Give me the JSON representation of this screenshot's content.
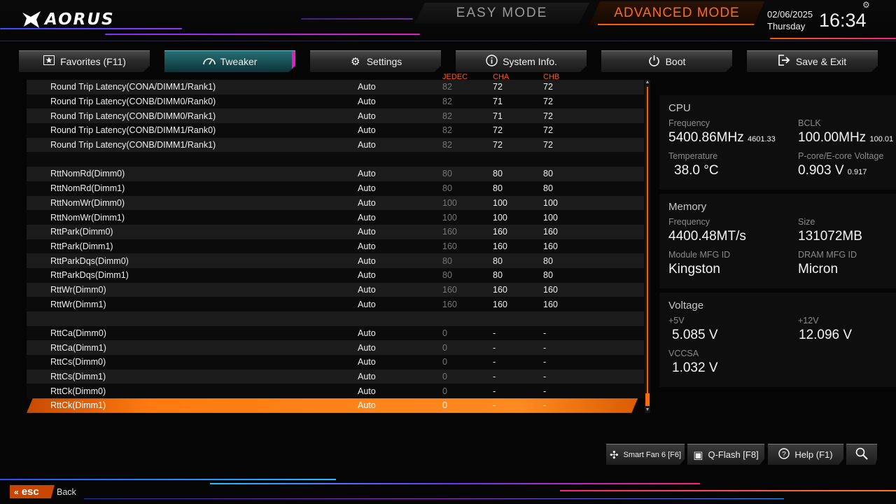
{
  "header": {
    "brand": "AORUS",
    "easy_mode": "EASY MODE",
    "advanced_mode": "ADVANCED MODE",
    "date": "02/06/2025",
    "day": "Thursday",
    "time": "16:34"
  },
  "tabs": [
    {
      "label": "Favorites (F11)",
      "icon": "star-icon"
    },
    {
      "label": "Tweaker",
      "icon": "speedometer-icon"
    },
    {
      "label": "Settings",
      "icon": "gear-icon"
    },
    {
      "label": "System Info.",
      "icon": "info-icon"
    },
    {
      "label": "Boot",
      "icon": "power-icon"
    },
    {
      "label": "Save & Exit",
      "icon": "exit-icon"
    }
  ],
  "columns": {
    "jedec": "JEDEC",
    "cha": "CHA",
    "chb": "CHB"
  },
  "rows": [
    {
      "name": "Round Trip Latency(CONA/DIMM1/Rank1)",
      "value": "Auto",
      "jedec": "82",
      "cha": "72",
      "chb": "72"
    },
    {
      "name": "Round Trip Latency(CONB/DIMM0/Rank0)",
      "value": "Auto",
      "jedec": "82",
      "cha": "71",
      "chb": "72"
    },
    {
      "name": "Round Trip Latency(CONB/DIMM0/Rank1)",
      "value": "Auto",
      "jedec": "82",
      "cha": "71",
      "chb": "72"
    },
    {
      "name": "Round Trip Latency(CONB/DIMM1/Rank0)",
      "value": "Auto",
      "jedec": "82",
      "cha": "72",
      "chb": "72"
    },
    {
      "name": "Round Trip Latency(CONB/DIMM1/Rank1)",
      "value": "Auto",
      "jedec": "82",
      "cha": "72",
      "chb": "72"
    },
    {
      "name": "",
      "value": "",
      "jedec": "",
      "cha": "",
      "chb": ""
    },
    {
      "name": "RttNomRd(Dimm0)",
      "value": "Auto",
      "jedec": "80",
      "cha": "80",
      "chb": "80"
    },
    {
      "name": "RttNomRd(Dimm1)",
      "value": "Auto",
      "jedec": "80",
      "cha": "80",
      "chb": "80"
    },
    {
      "name": "RttNomWr(Dimm0)",
      "value": "Auto",
      "jedec": "100",
      "cha": "100",
      "chb": "100"
    },
    {
      "name": "RttNomWr(Dimm1)",
      "value": "Auto",
      "jedec": "100",
      "cha": "100",
      "chb": "100"
    },
    {
      "name": "RttPark(Dimm0)",
      "value": "Auto",
      "jedec": "160",
      "cha": "160",
      "chb": "160"
    },
    {
      "name": "RttPark(Dimm1)",
      "value": "Auto",
      "jedec": "160",
      "cha": "160",
      "chb": "160"
    },
    {
      "name": "RttParkDqs(Dimm0)",
      "value": "Auto",
      "jedec": "80",
      "cha": "80",
      "chb": "80"
    },
    {
      "name": "RttParkDqs(Dimm1)",
      "value": "Auto",
      "jedec": "80",
      "cha": "80",
      "chb": "80"
    },
    {
      "name": "RttWr(Dimm0)",
      "value": "Auto",
      "jedec": "160",
      "cha": "160",
      "chb": "160"
    },
    {
      "name": "RttWr(Dimm1)",
      "value": "Auto",
      "jedec": "160",
      "cha": "160",
      "chb": "160"
    },
    {
      "name": "",
      "value": "",
      "jedec": "",
      "cha": "",
      "chb": ""
    },
    {
      "name": "RttCa(Dimm0)",
      "value": "Auto",
      "jedec": "0",
      "cha": "-",
      "chb": "-"
    },
    {
      "name": "RttCa(Dimm1)",
      "value": "Auto",
      "jedec": "0",
      "cha": "-",
      "chb": "-"
    },
    {
      "name": "RttCs(Dimm0)",
      "value": "Auto",
      "jedec": "0",
      "cha": "-",
      "chb": "-"
    },
    {
      "name": "RttCs(Dimm1)",
      "value": "Auto",
      "jedec": "0",
      "cha": "-",
      "chb": "-"
    },
    {
      "name": "RttCk(Dimm0)",
      "value": "Auto",
      "jedec": "0",
      "cha": "-",
      "chb": "-"
    },
    {
      "name": "RttCk(Dimm1)",
      "value": "Auto",
      "jedec": "0",
      "cha": "-",
      "chb": "-"
    }
  ],
  "selected_row": "RttCk(Dimm1)",
  "cpu": {
    "title": "CPU",
    "freq_label": "Frequency",
    "freq": "5400.86MHz",
    "freq_sub": "4601.33",
    "bclk_label": "BCLK",
    "bclk": "100.00MHz",
    "bclk_sub": "100.01",
    "temp_label": "Temperature",
    "temp": "38.0 °C",
    "volt_label": "P-core/E-core Voltage",
    "volt": "0.903 V",
    "volt_sub": "0.917"
  },
  "memory": {
    "title": "Memory",
    "freq_label": "Frequency",
    "freq": "4400.48MT/s",
    "size_label": "Size",
    "size": "131072MB",
    "module_label": "Module MFG ID",
    "module": "Kingston",
    "dram_label": "DRAM MFG ID",
    "dram": "Micron"
  },
  "voltage": {
    "title": "Voltage",
    "v5_label": "+5V",
    "v5": "5.085 V",
    "v12_label": "+12V",
    "v12": "12.096 V",
    "vccsa_label": "VCCSA",
    "vccsa": "1.032 V"
  },
  "bottom": {
    "smartfan": "Smart Fan 6 [F6]",
    "qflash": "Q-Flash [F8]",
    "help": "Help (F1)"
  },
  "footer": {
    "esc": "esc",
    "back": "Back"
  },
  "colors": {
    "accent": "#ff6a10",
    "tab_active": "#1d5a60",
    "magenta": "#e020c0"
  }
}
